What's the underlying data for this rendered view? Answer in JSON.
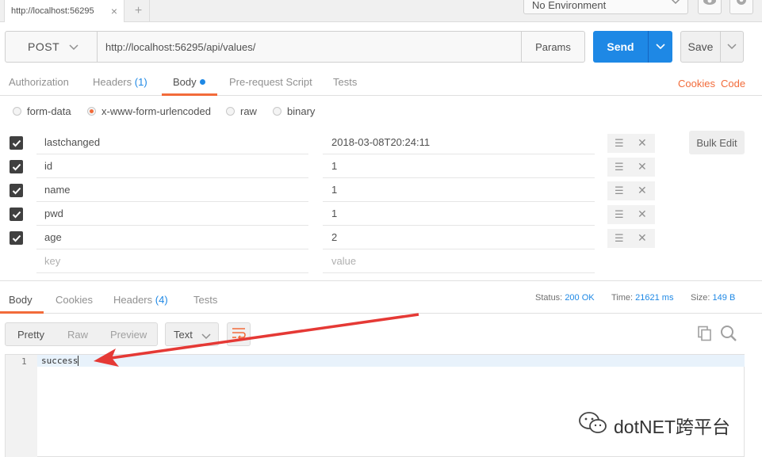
{
  "top": {
    "tab_label": "http://localhost:56295",
    "tab_close": "×",
    "new_tab": "+",
    "environment": "No Environment"
  },
  "request": {
    "method": "POST",
    "url": "http://localhost:56295/api/values/",
    "params_label": "Params",
    "send_label": "Send",
    "save_label": "Save"
  },
  "request_tabs": {
    "authorization": "Authorization",
    "headers": "Headers",
    "headers_count": "(1)",
    "body": "Body",
    "prerequest": "Pre-request Script",
    "tests": "Tests",
    "cookies": "Cookies",
    "code": "Code"
  },
  "body_types": {
    "form_data": "form-data",
    "urlencoded": "x-www-form-urlencoded",
    "raw": "raw",
    "binary": "binary",
    "selected": "x-www-form-urlencoded"
  },
  "params": [
    {
      "key": "lastchanged",
      "value": "2018-03-08T20:24:11",
      "checked": true
    },
    {
      "key": "id",
      "value": "1",
      "checked": true
    },
    {
      "key": "name",
      "value": "1",
      "checked": true
    },
    {
      "key": "pwd",
      "value": "1",
      "checked": true
    },
    {
      "key": "age",
      "value": "2",
      "checked": true
    }
  ],
  "new_row": {
    "key_placeholder": "key",
    "value_placeholder": "value"
  },
  "bulk_edit": "Bulk Edit",
  "response": {
    "tabs": {
      "body": "Body",
      "cookies": "Cookies",
      "headers": "Headers",
      "headers_count": "(4)",
      "tests": "Tests"
    },
    "status_label": "Status:",
    "status_value": "200 OK",
    "time_label": "Time:",
    "time_value": "21621 ms",
    "size_label": "Size:",
    "size_value": "149 B",
    "view_modes": {
      "pretty": "Pretty",
      "raw": "Raw",
      "preview": "Preview"
    },
    "format": "Text",
    "line_number": "1",
    "body_text": "success"
  },
  "watermark": "dotNET跨平台",
  "colors": {
    "accent_orange": "#f26b3a",
    "send_blue": "#1e88e5",
    "arrow_red": "#e53935"
  },
  "icons": {
    "environment_chevron": "chevron-down-icon",
    "eye": "eye-icon",
    "settings": "gear-icon",
    "method_chevron": "chevron-down-icon",
    "send_dropdown": "chevron-down-icon",
    "save_dropdown": "chevron-down-icon",
    "row_menu": "hamburger-icon",
    "row_delete": "close-icon",
    "wrap": "wrap-lines-icon",
    "copy": "copy-icon",
    "search": "search-icon",
    "watermark_logo": "wechat-icon"
  }
}
